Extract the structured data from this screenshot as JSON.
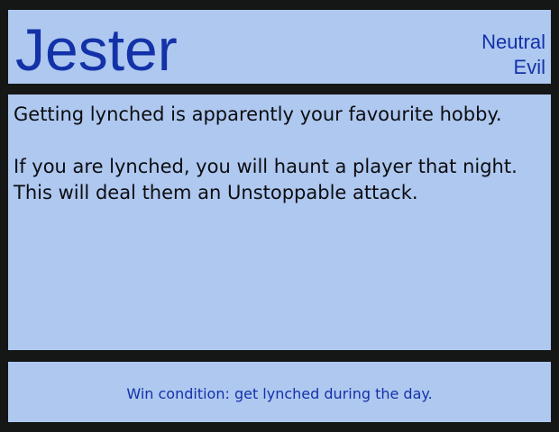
{
  "role": {
    "name": "Jester",
    "alignment_line1": "Neutral",
    "alignment_line2": "Evil"
  },
  "description": {
    "paragraph1": "Getting lynched is apparently your favourite hobby.",
    "paragraph2": "If you are lynched, you will haunt a player that night. This will deal them an Unstoppable attack."
  },
  "footer": {
    "win_condition": "Win condition: get lynched during the day."
  },
  "colors": {
    "panel_background": "#aec8f0",
    "border": "#151716",
    "accent_text": "#1432a8",
    "body_text": "#0c0c10"
  }
}
